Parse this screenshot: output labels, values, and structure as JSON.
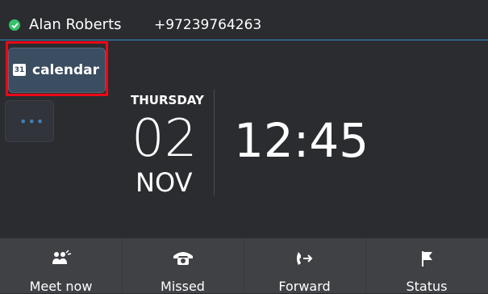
{
  "status_bar": {
    "user_name": "Alan Roberts",
    "phone_number": "+97239764263",
    "presence_color": "#38c06a"
  },
  "sidebar": {
    "calendar_button": {
      "label": "calendar",
      "icon_text": "31",
      "icon": "calendar-icon"
    },
    "more_tab": {
      "label": "•••",
      "icon": "more-dots-icon"
    }
  },
  "clock": {
    "weekday": "THURSDAY",
    "day": "02",
    "month": "NOV",
    "time": "12:45"
  },
  "softkeys": [
    {
      "label": "Meet now",
      "icon": "meet-now-icon"
    },
    {
      "label": "Missed",
      "icon": "missed-call-icon"
    },
    {
      "label": "Forward",
      "icon": "forward-call-icon"
    },
    {
      "label": "Status",
      "icon": "status-flag-icon"
    }
  ],
  "colors": {
    "accent_line": "#2f8fd0",
    "highlight": "#ea0a16",
    "background": "#2b2c30"
  }
}
